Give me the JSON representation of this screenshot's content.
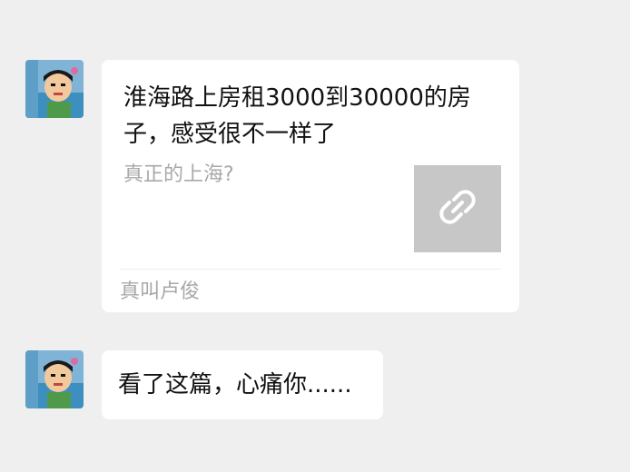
{
  "messages": [
    {
      "type": "link_card",
      "title": "淮海路上房租3000到30000的房子，感受很不一样了",
      "description": "真正的上海?",
      "thumbnail_icon": "link-icon",
      "source": "真叫卢俊"
    },
    {
      "type": "text",
      "text": "看了这篇，心痛你......"
    }
  ]
}
